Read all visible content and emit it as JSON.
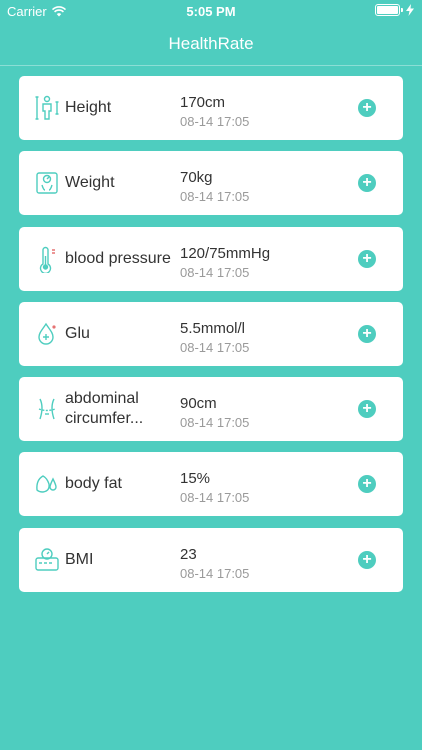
{
  "status_bar": {
    "carrier": "Carrier",
    "time": "5:05 PM",
    "wifi_icon": "wifi-icon",
    "battery_icon": "battery-icon",
    "charging_icon": "bolt-icon"
  },
  "nav": {
    "title": "HealthRate"
  },
  "colors": {
    "accent": "#4ecdbf",
    "card": "#ffffff",
    "text": "#333333",
    "subtext": "#9a9a9a"
  },
  "metrics": [
    {
      "icon": "height-icon",
      "label": "Height",
      "value": "170cm",
      "time": "08-14 17:05"
    },
    {
      "icon": "weight-scale-icon",
      "label": "Weight",
      "value": "70kg",
      "time": "08-14 17:05"
    },
    {
      "icon": "thermometer-icon",
      "label": "blood pressure",
      "value": "120/75mmHg",
      "time": "08-14 17:05"
    },
    {
      "icon": "glucose-drop-icon",
      "label": "Glu",
      "value": "5.5mmol/l",
      "time": "08-14 17:05"
    },
    {
      "icon": "waist-icon",
      "label": "abdominal circumfer...",
      "value": "90cm",
      "time": "08-14 17:05"
    },
    {
      "icon": "body-fat-icon",
      "label": "body fat",
      "value": "15%",
      "time": "08-14 17:05"
    },
    {
      "icon": "bmi-scale-icon",
      "label": "BMI",
      "value": "23",
      "time": "08-14 17:05"
    }
  ],
  "add_button_label": "+"
}
